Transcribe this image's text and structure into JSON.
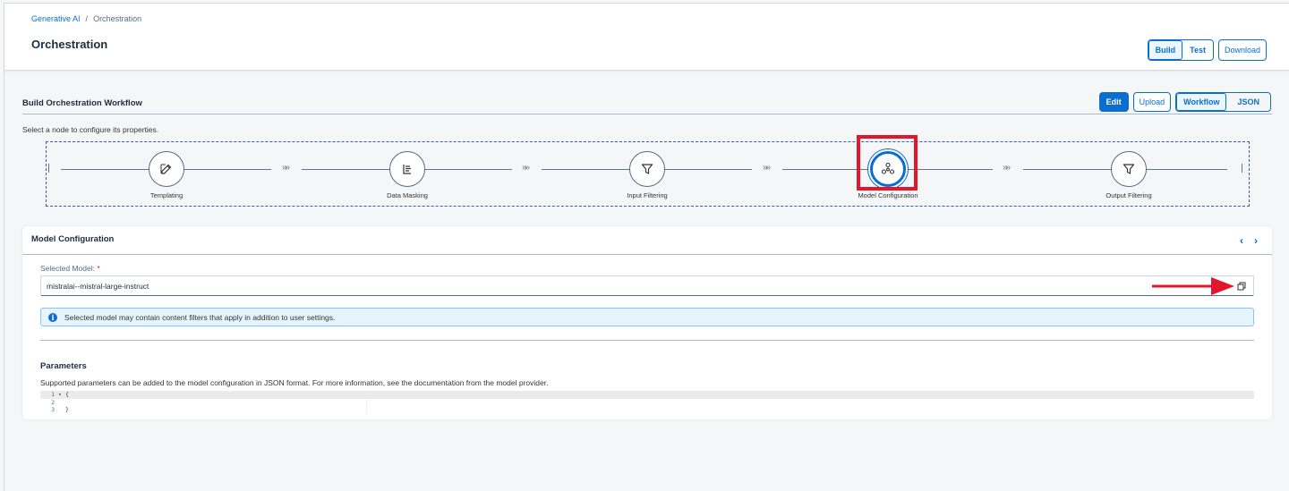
{
  "breadcrumb": {
    "root": "Generative AI",
    "separator": "/",
    "current": "Orchestration"
  },
  "page": {
    "title": "Orchestration"
  },
  "header_buttons": {
    "build": "Build",
    "test": "Test",
    "download": "Download"
  },
  "workflow": {
    "title": "Build Orchestration Workflow",
    "hint": "Select a node to configure its properties.",
    "buttons": {
      "edit": "Edit",
      "upload": "Upload",
      "workflow": "Workflow",
      "json": "JSON"
    },
    "connector": "»»",
    "nodes": [
      {
        "label": "Templating",
        "icon": "edit-icon"
      },
      {
        "label": "Data Masking",
        "icon": "document-lines-icon"
      },
      {
        "label": "Input Filtering",
        "icon": "filter-icon"
      },
      {
        "label": "Model Configuration",
        "icon": "network-nodes-icon",
        "selected": true
      },
      {
        "label": "Output Filtering",
        "icon": "filter-icon"
      }
    ]
  },
  "model_config": {
    "title": "Model Configuration",
    "nav_prev": "‹",
    "nav_next": "›",
    "selected_model_label": "Selected Model:",
    "required_marker": "*",
    "selected_model_value": "mistralai--mistral-large-instruct",
    "info_icon": "i",
    "info_message": "Selected model may contain content filters that apply in addition to user settings.",
    "parameters_title": "Parameters",
    "parameters_desc": "Supported parameters can be added to the model configuration in JSON format. For more information, see the documentation from the model provider.",
    "editor_lines": [
      {
        "num": "1",
        "fold": "▾",
        "code": "{"
      },
      {
        "num": "2",
        "fold": "",
        "code": ""
      },
      {
        "num": "3",
        "fold": "",
        "code": "}"
      }
    ]
  },
  "colors": {
    "accent": "#0a6ed1",
    "highlight": "#e3162b",
    "info_bg": "#e6f4fd"
  }
}
